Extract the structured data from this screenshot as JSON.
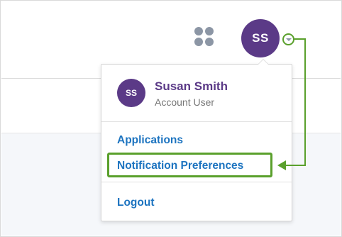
{
  "header": {
    "apps_icon": "apps-grid-icon",
    "avatar_initials": "SS"
  },
  "dropdown": {
    "user": {
      "initials": "SS",
      "name": "Susan Smith",
      "role": "Account User"
    },
    "menu": {
      "applications": "Applications",
      "notification_preferences": "Notification Preferences",
      "logout": "Logout"
    }
  },
  "colors": {
    "brand_purple": "#5b3a87",
    "link_blue": "#1d74c0",
    "highlight_green": "#5aa02c",
    "icon_gray": "#8c96a5"
  }
}
